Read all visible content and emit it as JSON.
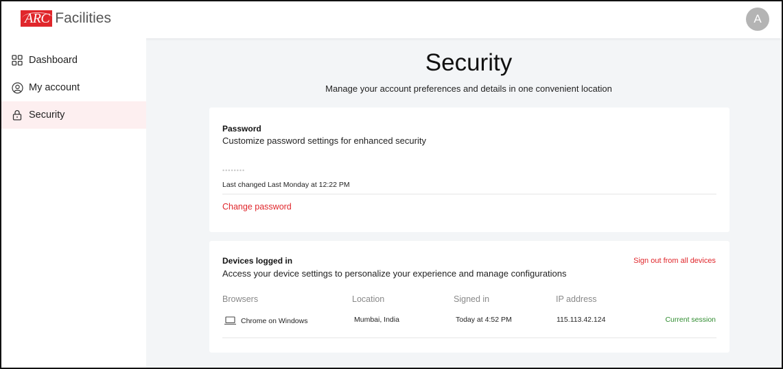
{
  "header": {
    "logo_mark": "ARC",
    "logo_text": "Facilities",
    "avatar_initial": "A"
  },
  "sidebar": {
    "items": [
      {
        "label": "Dashboard",
        "icon": "grid-icon",
        "active": false
      },
      {
        "label": "My account",
        "icon": "user-circle-icon",
        "active": false
      },
      {
        "label": "Security",
        "icon": "lock-icon",
        "active": true
      }
    ]
  },
  "page": {
    "title": "Security",
    "subtitle": "Manage your account preferences and details in one convenient location"
  },
  "password_card": {
    "title": "Password",
    "description": "Customize password settings for enhanced security",
    "masked": "••••••••",
    "last_changed": "Last changed Last Monday at 12:22 PM",
    "change_link": "Change password"
  },
  "devices_card": {
    "title": "Devices logged in",
    "description": "Access your device settings to personalize your experience and manage configurations",
    "sign_out_all": "Sign out from all devices",
    "columns": [
      "Browsers",
      "Location",
      "Signed in",
      "IP address"
    ],
    "rows": [
      {
        "browser": "Chrome on Windows",
        "location": "Mumbai, India",
        "signed_in": "Today at 4:52 PM",
        "ip": "115.113.42.124",
        "status": "Current session",
        "icon": "laptop-icon"
      }
    ]
  },
  "colors": {
    "accent_red": "#e0262b",
    "active_bg": "#fdeff0",
    "session_green": "#2e8b2e",
    "main_bg": "#f3f5f7"
  }
}
